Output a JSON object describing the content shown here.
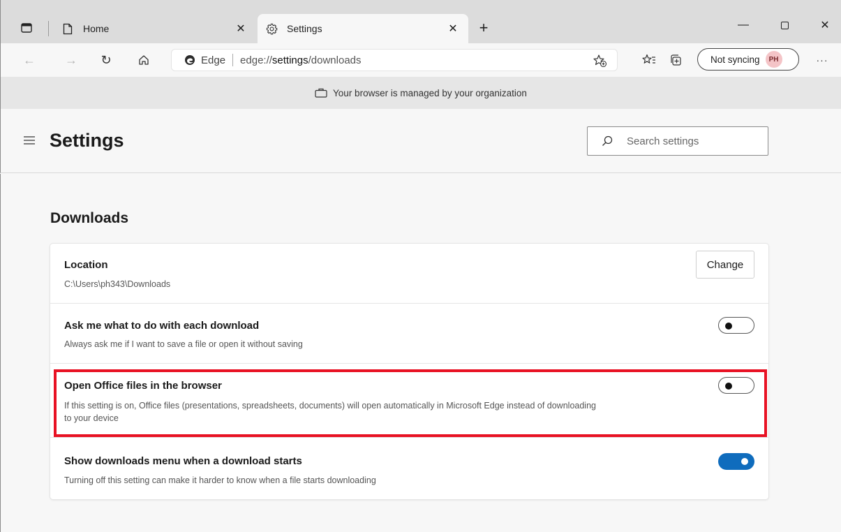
{
  "tabs": [
    {
      "title": "Home",
      "icon": "page-icon",
      "active": false
    },
    {
      "title": "Settings",
      "icon": "gear-icon",
      "active": true
    }
  ],
  "toolbar": {
    "site_label": "Edge",
    "url_prefix": "edge://",
    "url_bold": "settings",
    "url_suffix": "/downloads",
    "sync_label": "Not syncing",
    "avatar_initials": "PH",
    "more_label": "···"
  },
  "banner": {
    "text": "Your browser is managed by your organization"
  },
  "header": {
    "title": "Settings",
    "search_placeholder": "Search settings"
  },
  "section": {
    "title": "Downloads"
  },
  "settings": {
    "location": {
      "title": "Location",
      "path": "C:\\Users\\ph343\\Downloads",
      "button": "Change"
    },
    "ask": {
      "title": "Ask me what to do with each download",
      "desc": "Always ask me if I want to save a file or open it without saving",
      "enabled": false
    },
    "office": {
      "title": "Open Office files in the browser",
      "desc_line1": "If this setting is on, Office files (presentations, spreadsheets, documents) will open automatically in Microsoft Edge instead of downloading",
      "desc_line2": "to your device",
      "enabled": false,
      "highlighted": true
    },
    "menu": {
      "title": "Show downloads menu when a download starts",
      "desc": "Turning off this setting can make it harder to know when a file starts downloading",
      "enabled": true
    }
  },
  "colors": {
    "accent": "#0f6cbd",
    "highlight": "#e81123",
    "avatar_bg": "#f4c4c7"
  }
}
